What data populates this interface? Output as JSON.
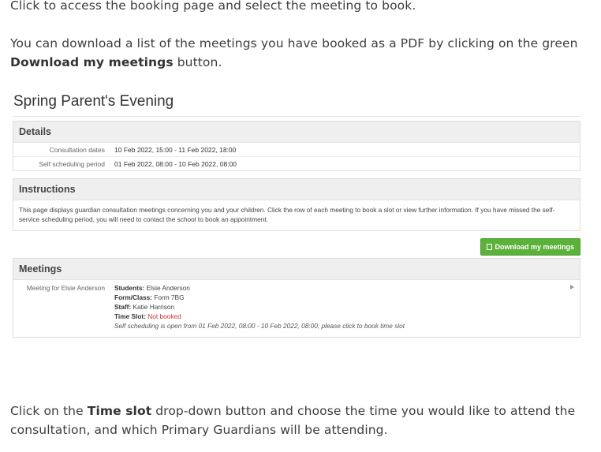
{
  "doc": {
    "top_text": "Click to access the booking page and select the meeting to book.",
    "download_pre": "You can download a list of the meetings you have booked as a PDF by clicking on the green ",
    "download_bold": "Download my meetings",
    "download_post": " button.",
    "bottom_pre": "Click on the ",
    "bottom_bold": "Time slot",
    "bottom_post": " drop-down button and choose the time you would like to attend the consultation, and which Primary Guardians will be attending."
  },
  "page": {
    "title": "Spring Parent's Evening"
  },
  "details": {
    "heading": "Details",
    "rows": [
      {
        "label": "Consultation dates",
        "value": "10 Feb 2022, 15:00 - 11 Feb 2022, 18:00"
      },
      {
        "label": "Self scheduling period",
        "value": "01 Feb 2022, 08:00 - 10 Feb 2022, 08:00"
      }
    ]
  },
  "instructions": {
    "heading": "Instructions",
    "text": "This page displays guardian consultation meetings concerning you and your children. Click the row of each meeting to book a slot or view further information. If you have missed the self-service scheduling period, you will need to contact the school to book an appointment."
  },
  "download_button": {
    "label": "Download my meetings",
    "color": "#5cb13a",
    "icon": "document-icon"
  },
  "meetings": {
    "heading": "Meetings",
    "items": [
      {
        "label": "Meeting for Elsie Anderson",
        "students_key": "Students:",
        "students": "Elsie Anderson",
        "form_key": "Form/Class:",
        "form": "Form 7BG",
        "staff_key": "Staff:",
        "staff": "Katie Harrison",
        "timeslot_key": "Time Slot:",
        "timeslot": "Not booked",
        "note": "Self scheduling is open from 01 Feb 2022, 08:00 - 10 Feb 2022, 08:00, please click to book time slot"
      }
    ]
  }
}
